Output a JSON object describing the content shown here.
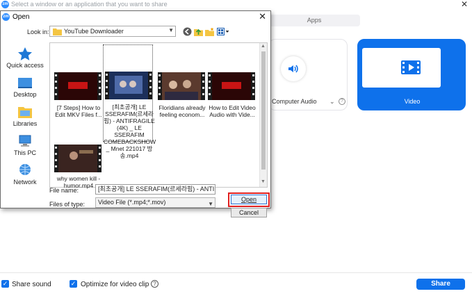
{
  "zoom": {
    "title": "Select a window or an application that you want to share",
    "logo_text": "zm",
    "close_glyph": "✕",
    "tabs": {
      "apps": "Apps"
    },
    "tiles": {
      "computer_audio": {
        "label": "Computer Audio",
        "chevron": "⌄",
        "help": "?"
      },
      "video": {
        "label": "Video"
      }
    },
    "bottom": {
      "share_sound": {
        "label": "Share sound",
        "checked": true
      },
      "optimize_video": {
        "label": "Optimize for video clip",
        "checked": true
      },
      "help": "?",
      "share_button": "Share"
    },
    "colors": {
      "accent": "#0e71eb"
    }
  },
  "dialog": {
    "title": "Open",
    "close_glyph": "✕",
    "look_in_label": "Look in:",
    "look_in_value": "YouTube Downloader",
    "toolbar_icons": [
      "back-icon",
      "up-folder-icon",
      "new-folder-icon",
      "view-menu-icon"
    ],
    "places": [
      {
        "label": "Quick access",
        "icon": "star-icon"
      },
      {
        "label": "Desktop",
        "icon": "desktop-icon"
      },
      {
        "label": "Libraries",
        "icon": "libraries-icon"
      },
      {
        "label": "This PC",
        "icon": "computer-icon"
      },
      {
        "label": "Network",
        "icon": "network-icon"
      }
    ],
    "files": [
      {
        "name": "[7 Steps] How to Edit MKV Files f...",
        "selected": false
      },
      {
        "name": "[최초공개] LE SSERAFIM(르세라핌) - ANTIFRAGILE (4K) _ LE SSERAFIM COMEBACKSHOW _ Mnet 221017 방송.mp4",
        "selected": true
      },
      {
        "name": "Floridians already feeling econom...",
        "selected": false
      },
      {
        "name": "How to Edit Video Audio with Vide...",
        "selected": false
      },
      {
        "name": "why women kill - humor.mp4",
        "selected": false
      }
    ],
    "file_name_label": "File name:",
    "file_name_value": "[최초공개] LE SSERAFIM(르세라핌) - ANTIFR/",
    "file_type_label": "Files of type:",
    "file_type_value": "Video File (*.mp4;*.mov)",
    "open_button": "Open",
    "cancel_button": "Cancel",
    "highlight_color": "#e02020"
  }
}
